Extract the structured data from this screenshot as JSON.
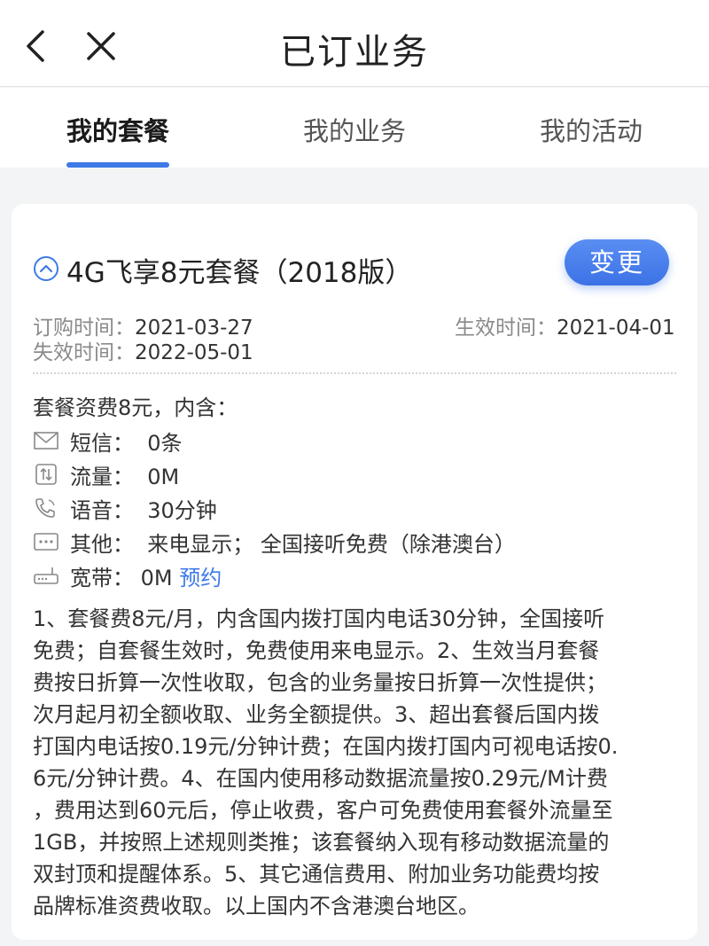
{
  "header": {
    "title": "已订业务",
    "back_icon": "chevron-left-icon",
    "close_icon": "close-icon"
  },
  "tabs": [
    {
      "label": "我的套餐",
      "active": true
    },
    {
      "label": "我的业务",
      "active": false
    },
    {
      "label": "我的活动",
      "active": false
    }
  ],
  "plan": {
    "name": "4G飞享8元套餐（2018版）",
    "change_label": "变更",
    "order_time_label": "订购时间：",
    "order_time": "2021-03-27",
    "effective_time_label": "生效时间：",
    "effective_time": "2021-04-01",
    "expire_time_label": "失效时间：",
    "expire_time": "2022-05-01",
    "includes_title": "套餐资费8元，内含：",
    "items": [
      {
        "icon": "envelope-icon",
        "label": "短信：",
        "value": "0条"
      },
      {
        "icon": "data-transfer-icon",
        "label": "流量：",
        "value": "0M"
      },
      {
        "icon": "phone-icon",
        "label": "语音：",
        "value": "30分钟"
      },
      {
        "icon": "more-dots-icon",
        "label": "其他：",
        "value": "来电显示；  全国接听免费（除港澳台）"
      },
      {
        "icon": "router-icon",
        "label": "宽带：",
        "value": "0M",
        "link": "预约"
      }
    ],
    "description_lines": [
      "1、套餐费8元/月，内含国内拨打国内电话30分钟，全国接听",
      "免费；自套餐生效时，免费使用来电显示。2、生效当月套餐",
      "费按日折算一次性收取，包含的业务量按日折算一次性提供；",
      "次月起月初全额收取、业务全额提供。3、超出套餐后国内拨",
      "打国内电话按0.19元/分钟计费；在国内拨打国内可视电话按0.",
      "6元/分钟计费。4、在国内使用移动数据流量按0.29元/M计费",
      "，费用达到60元后，停止收费，客户可免费使用套餐外流量至",
      "1GB，并按照上述规则类推；该套餐纳入现有移动数据流量的",
      "双封顶和提醒体系。5、其它通信费用、附加业务功能费均按",
      "品牌标准资费收取。以上国内不含港澳台地区。"
    ]
  },
  "colors": {
    "accent": "#3e7ae8",
    "background": "#f3f4f6"
  }
}
